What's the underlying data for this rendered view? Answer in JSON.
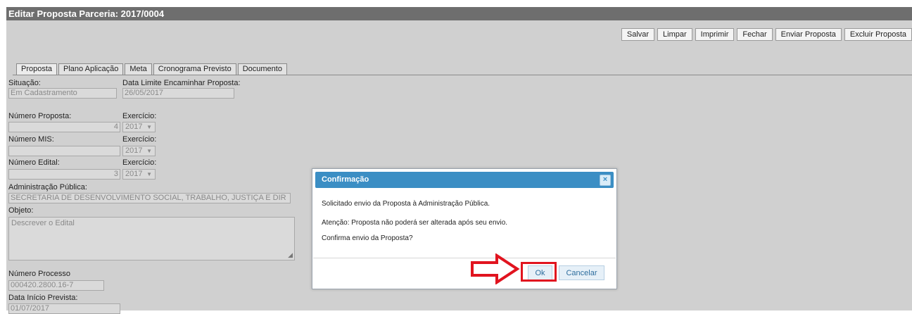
{
  "window": {
    "title": "Editar Proposta Parceria: 2017/0004"
  },
  "toolbar": {
    "buttons": [
      "Salvar",
      "Limpar",
      "Imprimir",
      "Fechar",
      "Enviar Proposta",
      "Excluir Proposta"
    ]
  },
  "tabs": [
    "Proposta",
    "Plano Aplicação",
    "Meta",
    "Cronograma Previsto",
    "Documento"
  ],
  "form": {
    "situacao": {
      "label": "Situação:",
      "value": "Em Cadastramento"
    },
    "data_limite": {
      "label": "Data Limite Encaminhar Proposta:",
      "value": "26/05/2017"
    },
    "numero_proposta": {
      "label": "Número Proposta:",
      "value": "4"
    },
    "exercicio_proposta": {
      "label": "Exercício:",
      "value": "2017"
    },
    "numero_mis": {
      "label": "Número MIS:",
      "value": ""
    },
    "exercicio_mis": {
      "label": "Exercício:",
      "value": "2017"
    },
    "numero_edital": {
      "label": "Número Edital:",
      "value": "3"
    },
    "exercicio_edital": {
      "label": "Exercício:",
      "value": "2017"
    },
    "administracao": {
      "label": "Administração Pública:",
      "value": "SECRETARIA DE DESENVOLVIMENTO SOCIAL, TRABALHO, JUSTIÇA E DIR"
    },
    "objeto": {
      "label": "Objeto:",
      "value": "Descrever o Edital"
    },
    "numero_processo": {
      "label": "Número Processo",
      "value": "000420.2800.16-7"
    },
    "data_inicio": {
      "label": "Data Início Prevista:",
      "value": "01/07/2017"
    }
  },
  "dialog": {
    "title": "Confirmação",
    "close_icon": "×",
    "messages": [
      "Solicitado envio da Proposta à Administração Pública.",
      "Atenção: Proposta não poderá ser alterada após seu envio.",
      "Confirma envio da Proposta?"
    ],
    "ok_label": "Ok",
    "cancel_label": "Cancelar"
  },
  "annotation": {
    "arrow_color": "#e1141f",
    "highlight_color": "#e1141f"
  }
}
